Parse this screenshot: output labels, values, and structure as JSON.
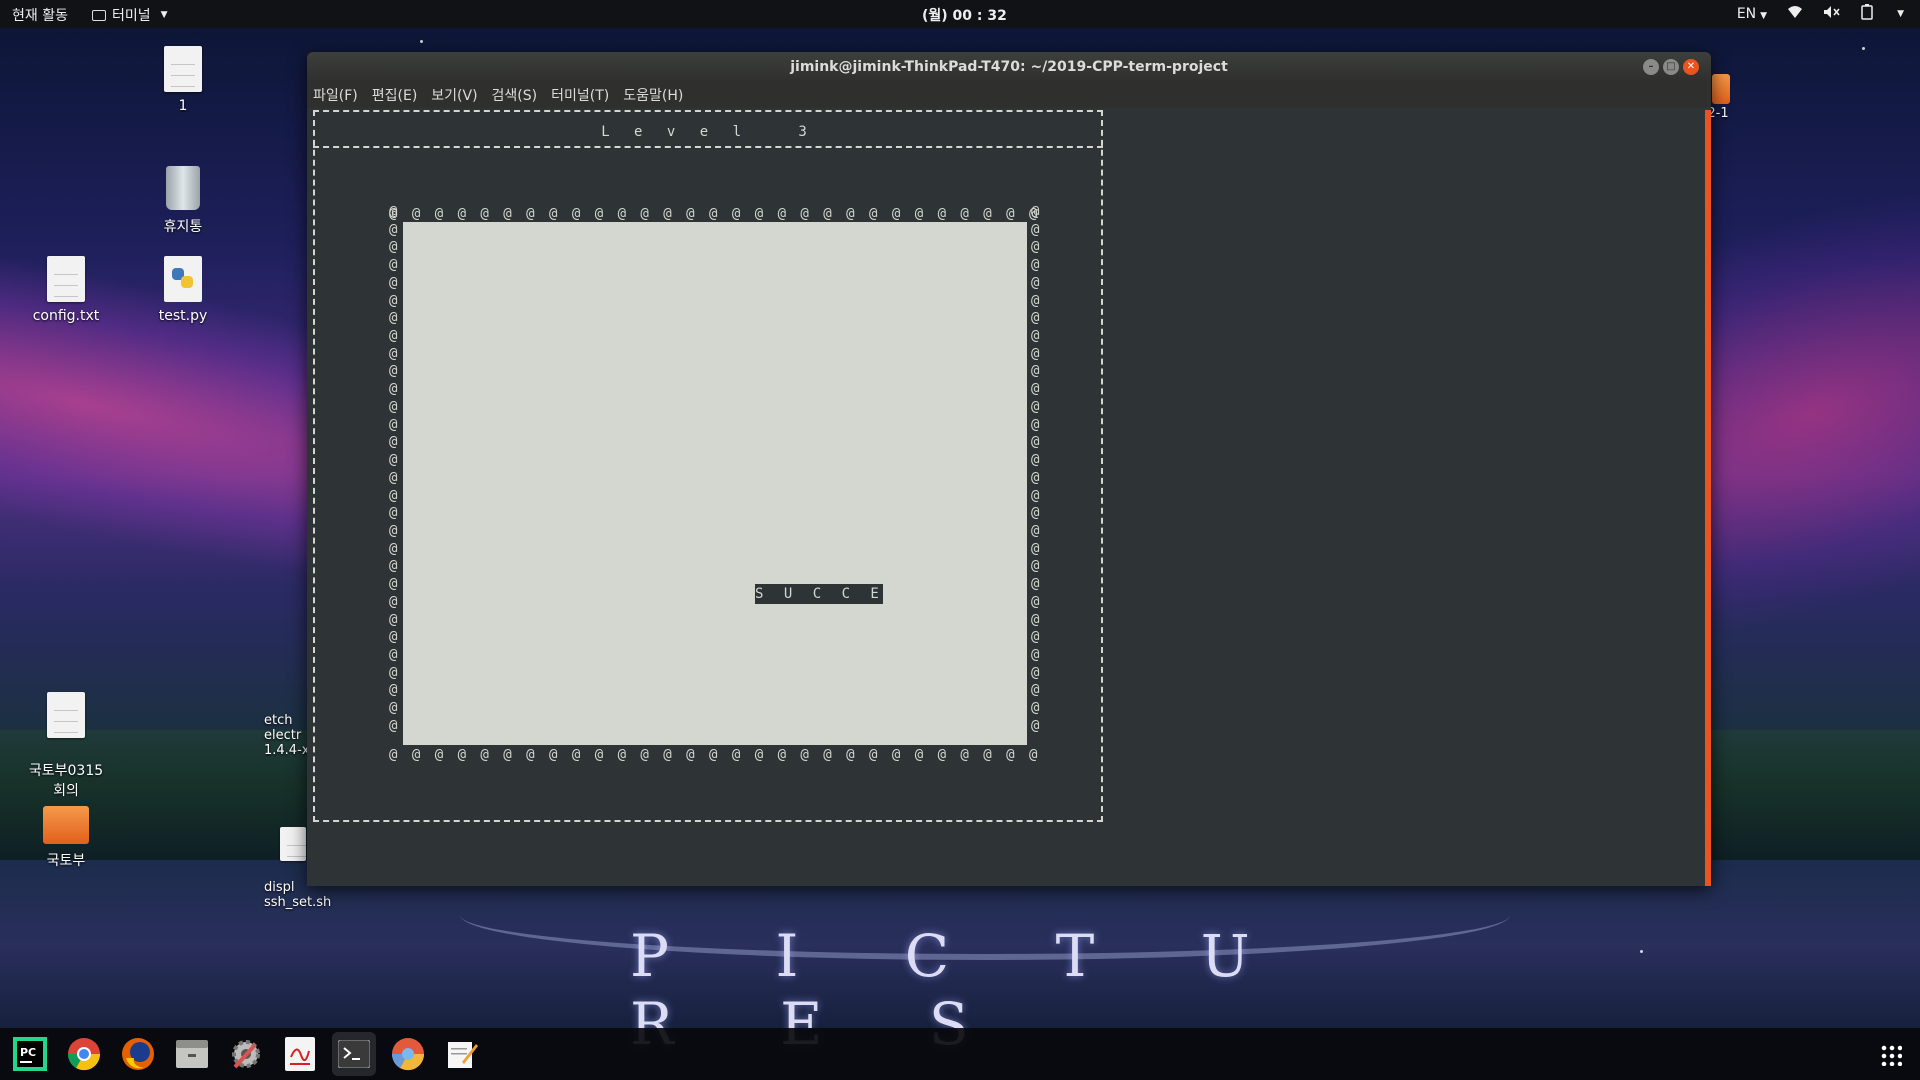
{
  "topbar": {
    "activities": "현재 활동",
    "app_name": "터미널",
    "clock": "(월) 00 : 32",
    "language": "EN"
  },
  "desktop": {
    "icons": [
      {
        "label": "1",
        "type": "document"
      },
      {
        "label": "휴지통",
        "type": "trash"
      },
      {
        "label": "config.txt",
        "type": "document"
      },
      {
        "label": "test.py",
        "type": "python"
      },
      {
        "label": "국토부0315\n회의",
        "type": "document"
      },
      {
        "label": "국토부",
        "type": "folder"
      },
      {
        "label": "etch\nelectr\n1.4.4-x",
        "type": "app"
      },
      {
        "label": "displ\nssh_set.sh",
        "type": "document"
      },
      {
        "label": "2-1",
        "type": "folder"
      }
    ],
    "wallpaper_text": "P I C T U R E S"
  },
  "window": {
    "title": "jimink@jimink-ThinkPad-T470: ~/2019-CPP-term-project",
    "menu": [
      "파일(F)",
      "편집(E)",
      "보기(V)",
      "검색(S)",
      "터미널(T)",
      "도움말(H)"
    ]
  },
  "game": {
    "level_label": "L e v e l   3",
    "border_char": "@",
    "message": "S U C C E S S !",
    "status": "success"
  },
  "dock": {
    "apps": [
      "PyCharm",
      "Chrome",
      "Firefox",
      "Files",
      "Settings",
      "Text Editor Red",
      "Terminal",
      "Chromium",
      "Notes"
    ]
  },
  "colors": {
    "accent": "#e95420",
    "terminal_bg": "#2e3436",
    "terminal_fg": "#d3d7cf"
  }
}
